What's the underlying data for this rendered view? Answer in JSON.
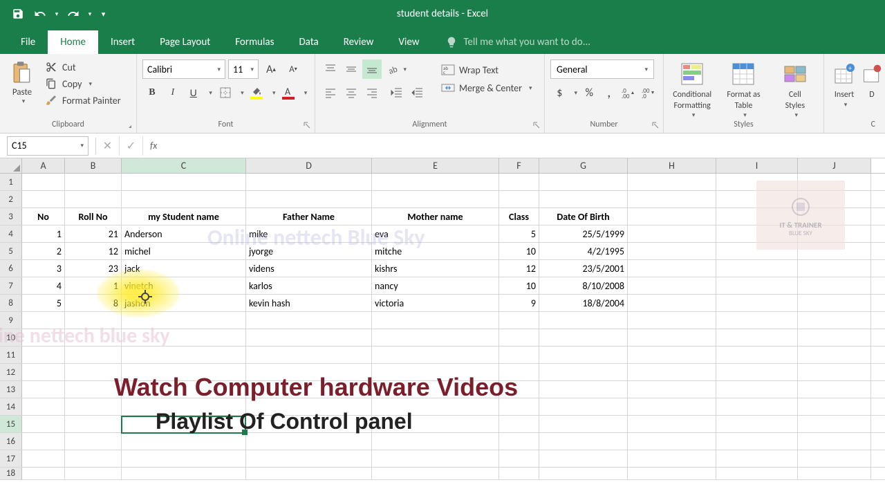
{
  "title": "student details - Excel",
  "tabs": [
    "File",
    "Home",
    "Insert",
    "Page Layout",
    "Formulas",
    "Data",
    "Review",
    "View"
  ],
  "active_tab": "Home",
  "tell_me": "Tell me what you want to do...",
  "clipboard": {
    "paste": "Paste",
    "cut": "Cut",
    "copy": "Copy",
    "format_painter": "Format Painter",
    "label": "Clipboard"
  },
  "font": {
    "name": "Calibri",
    "size": "11",
    "label": "Font"
  },
  "alignment": {
    "wrap": "Wrap Text",
    "merge": "Merge & Center",
    "label": "Alignment"
  },
  "number": {
    "format": "General",
    "label": "Number"
  },
  "styles": {
    "conditional": "Conditional\nFormatting",
    "table": "Format as\nTable",
    "cell": "Cell\nStyles",
    "label": "Styles"
  },
  "cells": {
    "insert": "Insert",
    "delete": "D",
    "label": "C"
  },
  "name_box": "C15",
  "columns": [
    "A",
    "B",
    "C",
    "D",
    "E",
    "F",
    "G",
    "H",
    "I",
    "J"
  ],
  "headers": {
    "no": "No",
    "roll": "Roll No",
    "student": "my Student name",
    "father": "Father Name",
    "mother": "Mother name",
    "class": "Class",
    "dob": "Date Of Birth"
  },
  "rows": [
    {
      "no": "1",
      "roll": "21",
      "student": "Anderson",
      "father": "mike",
      "mother": "eva",
      "class": "5",
      "dob": "25/5/1999"
    },
    {
      "no": "2",
      "roll": "12",
      "student": "michel",
      "father": "jyorge",
      "mother": "mitche",
      "class": "10",
      "dob": "4/2/1995"
    },
    {
      "no": "3",
      "roll": "23",
      "student": "jack",
      "father": "videns",
      "mother": "kishrs",
      "class": "12",
      "dob": "23/5/2001"
    },
    {
      "no": "4",
      "roll": "1",
      "student": "vinetch",
      "father": "karlos",
      "mother": "nancy",
      "class": "10",
      "dob": "8/10/2008"
    },
    {
      "no": "5",
      "roll": "8",
      "student": "jashon",
      "father": "kevin hash",
      "mother": "victoria",
      "class": "9",
      "dob": "18/8/2004"
    }
  ],
  "overlay": {
    "watermark1": "Online nettech Blue Sky",
    "watermark2": "line nettech blue sky",
    "line1": "Watch Computer hardware Videos",
    "line2": "Playlist Of Control  panel",
    "logo1": "IT & TRAINER",
    "logo2": "BLUE SKY"
  }
}
